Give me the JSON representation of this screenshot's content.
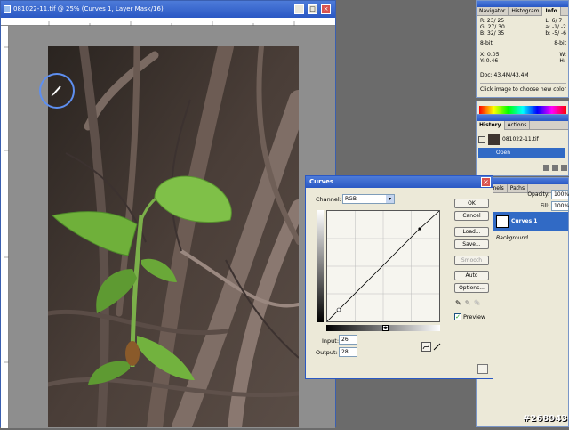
{
  "document": {
    "title": "081022-11.tif @ 25% (Curves 1, Layer Mask/16)",
    "minimize": "_",
    "maximize": "□",
    "close": "×"
  },
  "ruler": {
    "top_marks": [
      "0",
      "1",
      "2",
      "3",
      "4",
      "5",
      "6",
      "7"
    ],
    "left_marks": [
      "0",
      "1",
      "2",
      "3"
    ]
  },
  "info_panel": {
    "tabs": [
      "Navigator",
      "Histogram",
      "Info"
    ],
    "active_tab": "Info",
    "rgb_left": {
      "R": "23/ 25",
      "G": "27/ 30",
      "B": "32/ 35"
    },
    "lab_right": {
      "L": "6/ 7",
      "a": "-1/ -2",
      "b": "-5/ -6"
    },
    "bit_left": "8-bit",
    "bit_right": "8-bit",
    "x": "0.05",
    "y": "0.46",
    "w_label": "W:",
    "h_label": "H:",
    "doc_size": "Doc: 43.4M/43.4M",
    "hint": "Click image to choose new color"
  },
  "history_panel": {
    "tabs": [
      "History",
      "Actions"
    ],
    "snapshot": "081022-11.tif",
    "state": "Open"
  },
  "layers_panel": {
    "tabs": [
      "Channels",
      "Paths"
    ],
    "opacity_label": "Opacity:",
    "opacity_value": "100%",
    "fill_label": "Fill:",
    "fill_value": "100%",
    "layers": [
      "Curves 1",
      "Background"
    ]
  },
  "curves_dialog": {
    "title": "Curves",
    "channel_label": "Channel:",
    "channel_value": "RGB",
    "buttons": [
      "OK",
      "Cancel",
      "Load...",
      "Save...",
      "Smooth",
      "Auto",
      "Options..."
    ],
    "input_label": "Input:",
    "input_value": "26",
    "output_label": "Output:",
    "output_value": "28",
    "preview_label": "Preview",
    "preview_checked": true
  },
  "watermark": "#268943"
}
